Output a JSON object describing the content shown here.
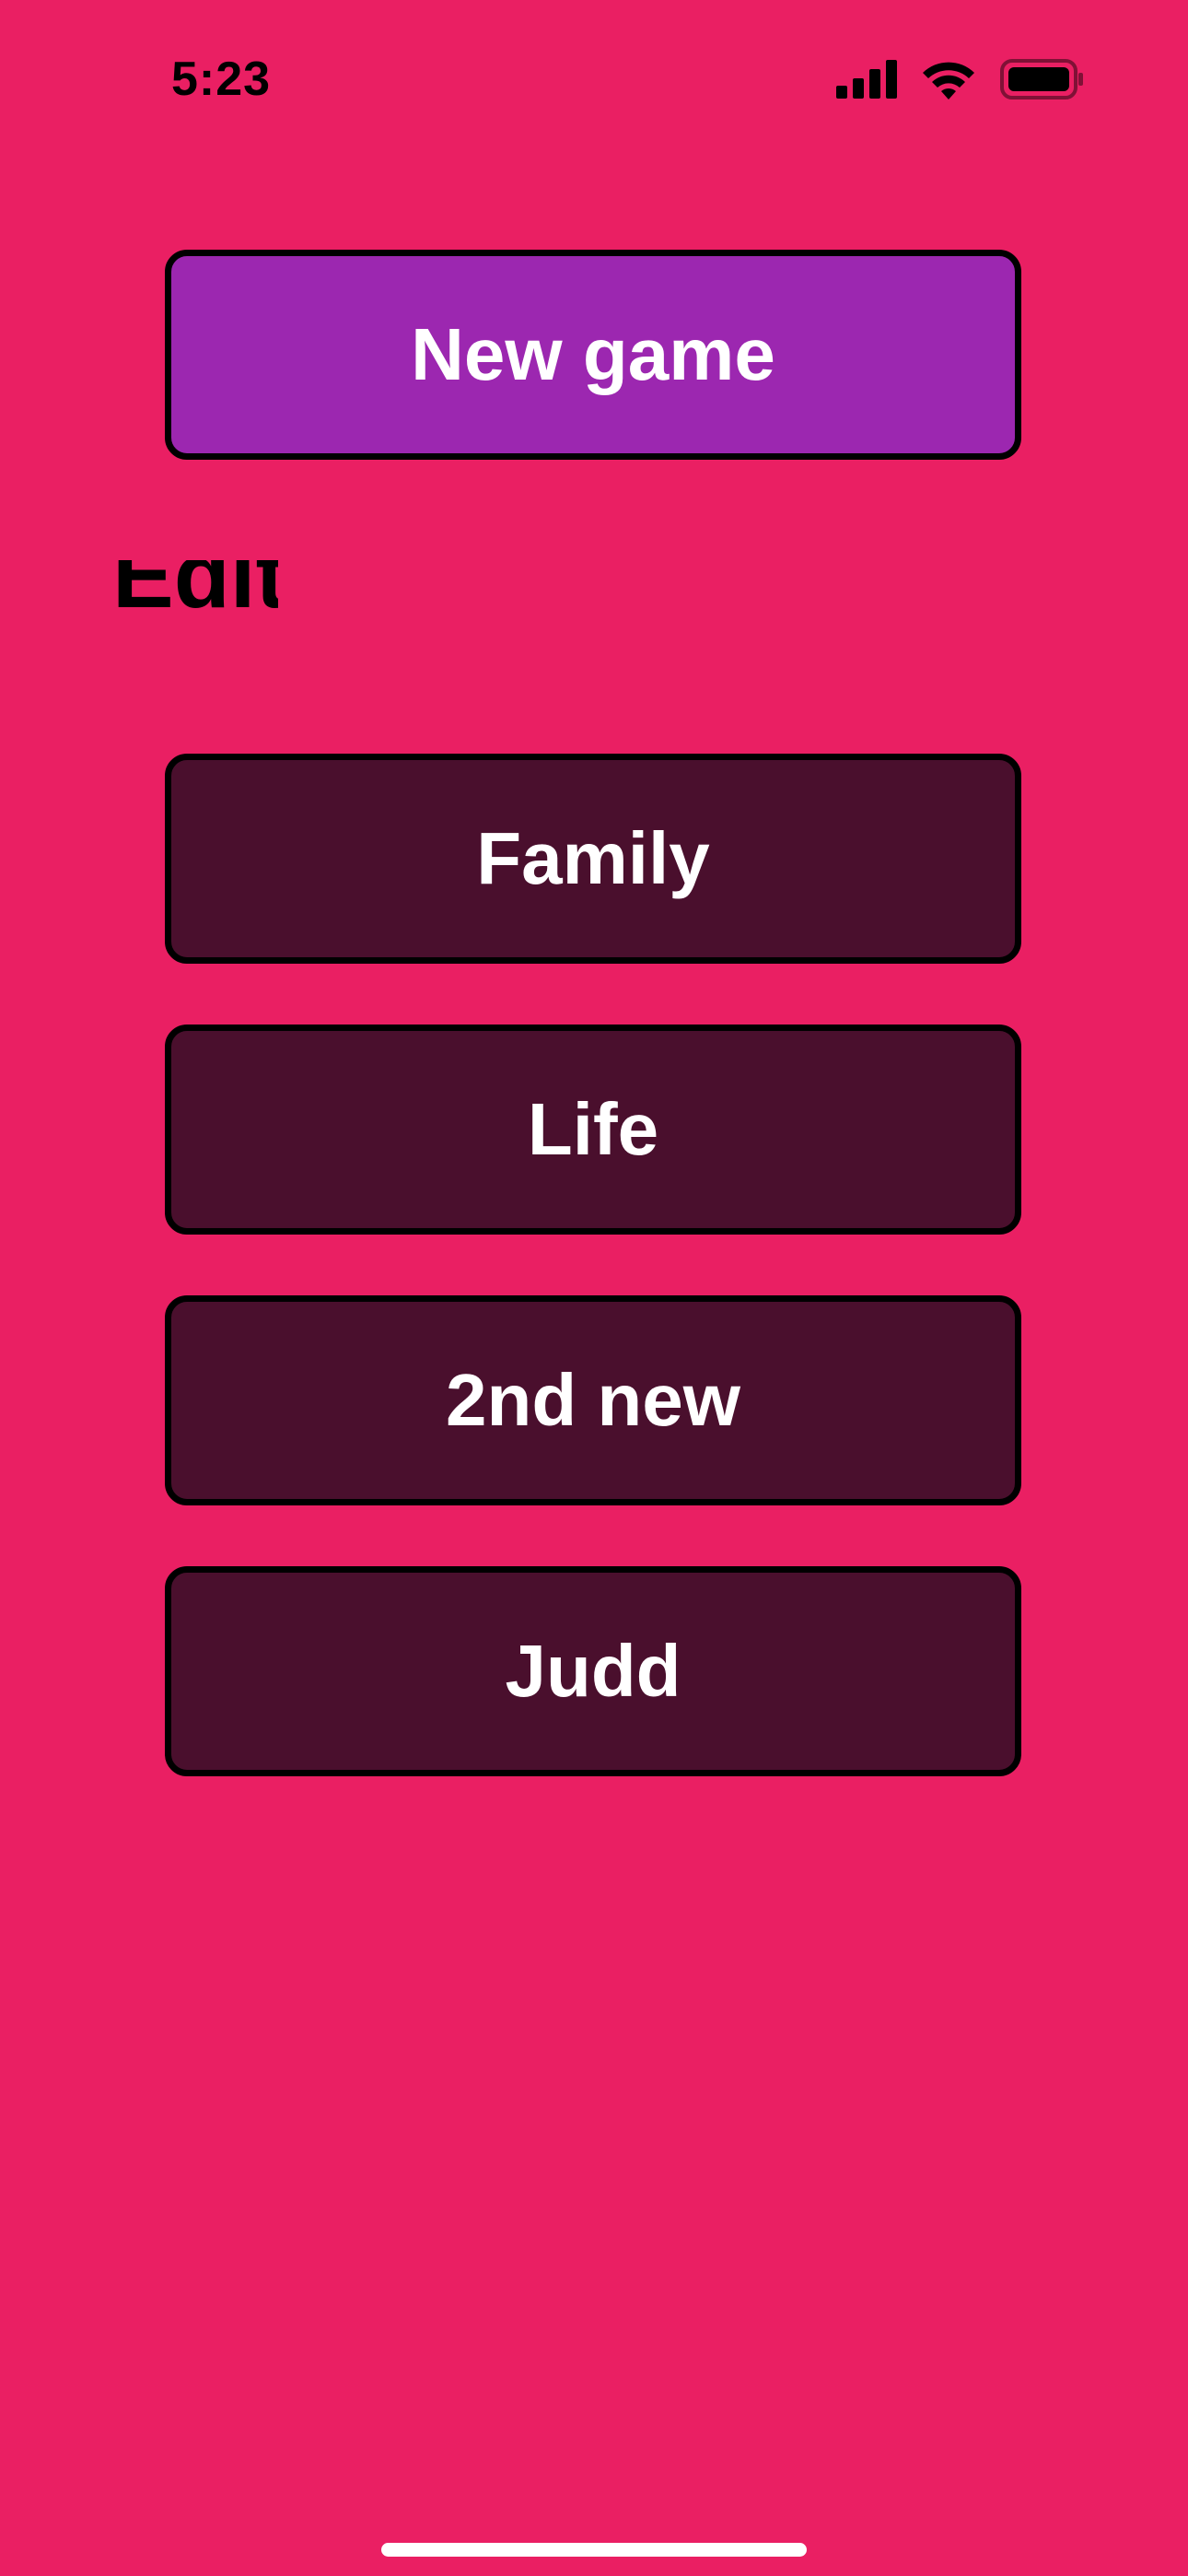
{
  "status_bar": {
    "time": "5:23",
    "icons": [
      "cellular-signal-icon",
      "wifi-icon",
      "battery-icon"
    ]
  },
  "main": {
    "new_game_label": "New game",
    "section_label": "Edit",
    "decks": [
      {
        "label": "Family"
      },
      {
        "label": "Life"
      },
      {
        "label": "2nd new"
      },
      {
        "label": "Judd"
      }
    ]
  },
  "colors": {
    "background": "#EA1F63",
    "primary_button": "#9C27B0",
    "deck_button": "#4A0F2D",
    "button_text": "#FFFFFF",
    "border": "#000000"
  }
}
